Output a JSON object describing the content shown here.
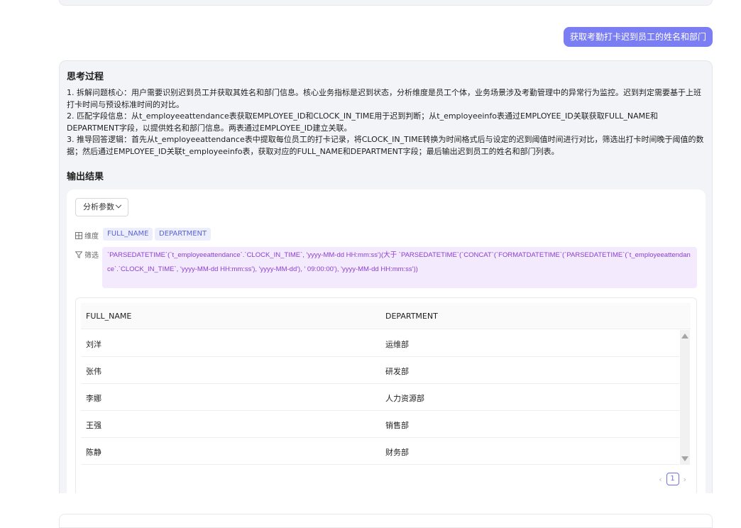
{
  "query": "获取考勤打卡迟到员工的姓名和部门",
  "thinking": {
    "title": "思考过程",
    "paragraphs": [
      "1. 拆解问题核心：用户需要识别迟到员工并获取其姓名和部门信息。核心业务指标是迟到状态，分析维度是员工个体，业务场景涉及考勤管理中的异常行为监控。迟到判定需要基于上班打卡时间与预设标准时间的对比。",
      "2. 匹配字段信息：从t_employeeattendance表获取EMPLOYEE_ID和CLOCK_IN_TIME用于迟到判断；从t_employeeinfo表通过EMPLOYEE_ID关联获取FULL_NAME和DEPARTMENT字段，以提供姓名和部门信息。两表通过EMPLOYEE_ID建立关联。",
      "3. 推导回答逻辑：首先从t_employeeattendance表中提取每位员工的打卡记录，将CLOCK_IN_TIME转换为时间格式后与设定的迟到阈值时间进行对比，筛选出打卡时间晚于阈值的数据；然后通过EMPLOYEE_ID关联t_employeeinfo表，获取对应的FULL_NAME和DEPARTMENT字段；最后输出迟到员工的姓名和部门列表。"
    ]
  },
  "result": {
    "title": "输出结果",
    "params_button": "分析参数",
    "dimension_label": "维度",
    "dimensions": [
      "FULL_NAME",
      "DEPARTMENT"
    ],
    "filter_label": "筛选",
    "filter_text": "`PARSEDATETIME`(`t_employeeattendance`.`CLOCK_IN_TIME`, 'yyyy-MM-dd HH:mm:ss')(大于 `PARSEDATETIME`(`CONCAT`(`FORMATDATETIME`(`PARSEDATETIME`(`t_employeeattendance`.`CLOCK_IN_TIME`, 'yyyy-MM-dd HH:mm:ss'), 'yyyy-MM-dd'), ' 09:00:00'), 'yyyy-MM-dd HH:mm:ss'))",
    "table": {
      "columns": [
        "FULL_NAME",
        "DEPARTMENT"
      ],
      "rows": [
        [
          "刘洋",
          "运维部"
        ],
        [
          "张伟",
          "研发部"
        ],
        [
          "李娜",
          "人力资源部"
        ],
        [
          "王强",
          "销售部"
        ],
        [
          "陈静",
          "财务部"
        ]
      ]
    },
    "pagination": {
      "current_page": "1",
      "prev": "‹",
      "next": "›"
    }
  },
  "icons": {
    "dimension": "grid-icon",
    "filter": "filter-funnel-icon"
  },
  "colors": {
    "accent": "#7b7ef2",
    "tag_bg": "#eceefb",
    "filter_bg": "#f3eafd",
    "filter_text": "#8a3fd1"
  }
}
